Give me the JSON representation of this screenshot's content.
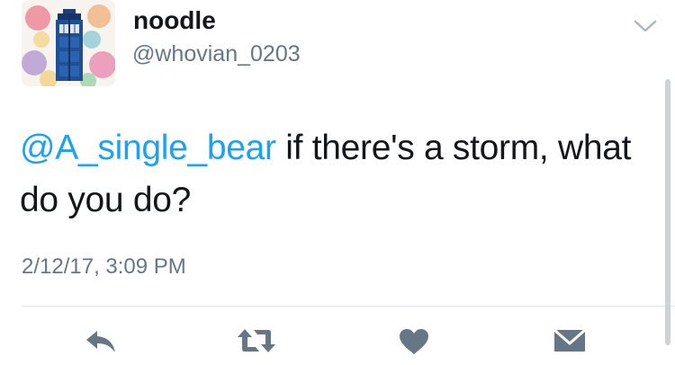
{
  "user": {
    "display_name": "noodle",
    "handle": "@whovian_0203",
    "avatar_icon": "tardis-watercolor-avatar"
  },
  "tweet": {
    "mention": "@A_single_bear",
    "text": " if there's a storm, what do you do?",
    "timestamp": "2/12/17, 3:09 PM"
  },
  "actions": [
    {
      "name": "reply",
      "icon": "reply-icon"
    },
    {
      "name": "retweet",
      "icon": "retweet-icon"
    },
    {
      "name": "like",
      "icon": "heart-icon"
    },
    {
      "name": "direct-message",
      "icon": "envelope-icon"
    }
  ],
  "colors": {
    "mention": "#1da1f2",
    "secondary_text": "#657786",
    "icon_gray": "#657786",
    "divider": "#e1e8ed"
  }
}
